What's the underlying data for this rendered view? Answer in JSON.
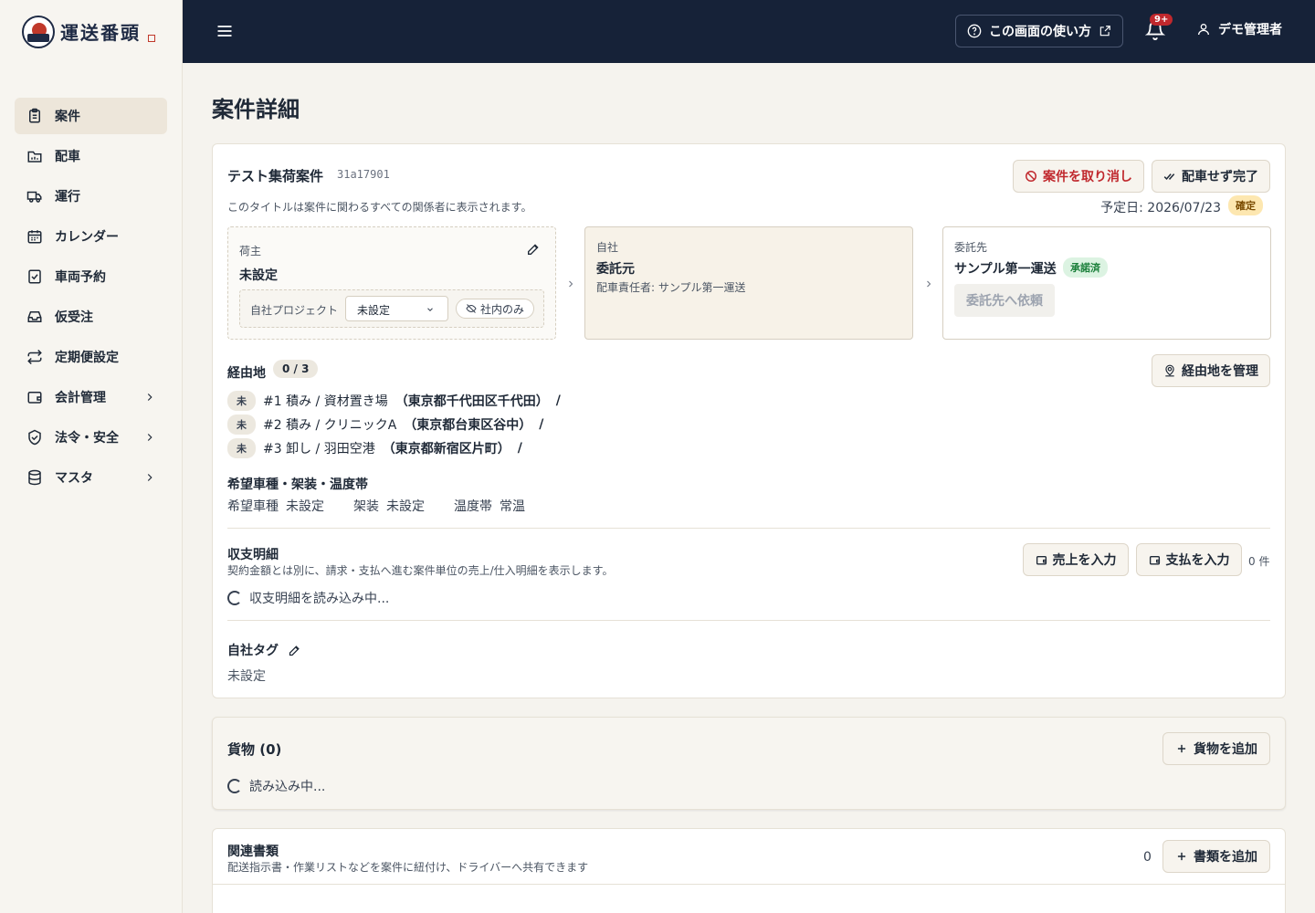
{
  "brand": {
    "name": "運送番頭"
  },
  "sidebar": {
    "items": [
      {
        "label": "案件",
        "icon": "clipboard-icon",
        "active": true
      },
      {
        "label": "配車",
        "icon": "calendar-truck-icon"
      },
      {
        "label": "運行",
        "icon": "truck-icon"
      },
      {
        "label": "カレンダー",
        "icon": "calendar-icon"
      },
      {
        "label": "車両予約",
        "icon": "calendar-check-icon"
      },
      {
        "label": "仮受注",
        "icon": "inbox-icon"
      },
      {
        "label": "定期便設定",
        "icon": "repeat-icon"
      },
      {
        "label": "会計管理",
        "icon": "wallet-icon",
        "expandable": true
      },
      {
        "label": "法令・安全",
        "icon": "shield-icon",
        "expandable": true
      },
      {
        "label": "マスタ",
        "icon": "database-icon",
        "expandable": true
      }
    ]
  },
  "topbar": {
    "help_label": "この画面の使い方",
    "notification_badge": "9+",
    "user_name": "デモ管理者"
  },
  "page": {
    "title": "案件詳細"
  },
  "case": {
    "title": "テスト集荷案件",
    "id": "31a17901",
    "hint": "このタイトルは案件に関わるすべての関係者に表示されます。",
    "cancel_label": "案件を取り消し",
    "complete_label": "配車せず完了",
    "scheduled": "予定日: 2026/07/23",
    "status": "確定"
  },
  "parties": {
    "shipper": {
      "label": "荷主",
      "name": "未設定",
      "project_label": "自社プロジェクト",
      "project_value": "未設定",
      "visibility": "社内のみ"
    },
    "self": {
      "label": "自社",
      "name": "委託元",
      "manager": "配車責任者: サンプル第一運送"
    },
    "subcontractor": {
      "label": "委託先",
      "name": "サンプル第一運送",
      "status": "承諾済",
      "request_label": "委託先へ依頼"
    }
  },
  "route": {
    "title": "経由地",
    "count": "0 / 3",
    "manage_label": "経由地を管理",
    "stops": [
      {
        "status": "未",
        "text": "#1 積み / 資材置き場",
        "addr": "（東京都千代田区千代田）",
        "tail": "/"
      },
      {
        "status": "未",
        "text": "#2 積み / クリニックA",
        "addr": "（東京都台東区谷中）",
        "tail": "/"
      },
      {
        "status": "未",
        "text": "#3 卸し / 羽田空港",
        "addr": "（東京都新宿区片町）",
        "tail": "/"
      }
    ]
  },
  "vehicle": {
    "title": "希望車種・架装・温度帯",
    "type_label": "希望車種",
    "type_value": "未設定",
    "body_label": "架装",
    "body_value": "未設定",
    "temp_label": "温度帯",
    "temp_value": "常温"
  },
  "finance": {
    "title": "収支明細",
    "hint": "契約金額とは別に、請求・支払へ進む案件単位の売上/仕入明細を表示します。",
    "sales_label": "売上を入力",
    "pay_label": "支払を入力",
    "count": "0 件",
    "loading": "収支明細を読み込み中..."
  },
  "tags": {
    "title": "自社タグ",
    "value": "未設定"
  },
  "cargo": {
    "title": "貨物 (0)",
    "add_label": "貨物を追加",
    "loading": "読み込み中..."
  },
  "docs": {
    "title": "関連書類",
    "hint": "配送指示書・作業リストなどを案件に紐付け、ドライバーへ共有できます",
    "count": "0",
    "add_label": "書類を追加"
  },
  "colors": {
    "topbar": "#162238",
    "danger": "#c0282d",
    "accent_bg": "#f7f2e8"
  }
}
